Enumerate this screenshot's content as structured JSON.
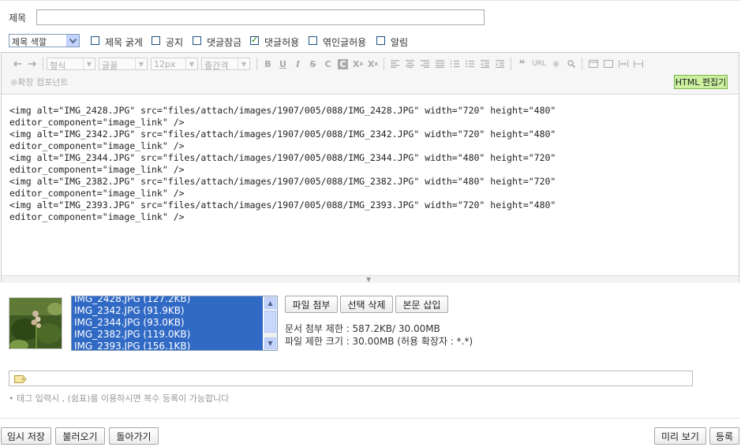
{
  "form": {
    "title_label": "제목",
    "title_value": "",
    "color_select": "제목 색깔",
    "checkboxes": [
      {
        "label": "제목 굵게",
        "checked": false
      },
      {
        "label": "공지",
        "checked": false
      },
      {
        "label": "댓글잠금",
        "checked": false
      },
      {
        "label": "댓글허용",
        "checked": true
      },
      {
        "label": "엮인글허용",
        "checked": false
      },
      {
        "label": "알림",
        "checked": false
      }
    ]
  },
  "toolbar": {
    "format_select": "형식",
    "font_select": "글꼴",
    "size_select": "12px",
    "spacing_select": "줄간격",
    "url_label": "URL",
    "extension_label": "확장 컴포넌트",
    "html_edit_label": "HTML 편집기"
  },
  "editor": {
    "lines": [
      "<img alt=\"IMG_2428.JPG\" src=\"files/attach/images/1907/005/088/IMG_2428.JPG\" width=\"720\" height=\"480\"",
      "editor_component=\"image_link\" />",
      "<img alt=\"IMG_2342.JPG\" src=\"files/attach/images/1907/005/088/IMG_2342.JPG\" width=\"720\" height=\"480\"",
      "editor_component=\"image_link\" />",
      "<img alt=\"IMG_2344.JPG\" src=\"files/attach/images/1907/005/088/IMG_2344.JPG\" width=\"480\" height=\"720\"",
      "editor_component=\"image_link\" />",
      "<img alt=\"IMG_2382.JPG\" src=\"files/attach/images/1907/005/088/IMG_2382.JPG\" width=\"480\" height=\"720\"",
      "editor_component=\"image_link\" />",
      "<img alt=\"IMG_2393.JPG\" src=\"files/attach/images/1907/005/088/IMG_2393.JPG\" width=\"720\" height=\"480\"",
      "editor_component=\"image_link\" />"
    ]
  },
  "attachments": {
    "files": [
      "IMG_2428.JPG (127.2KB)",
      "IMG_2342.JPG (91.9KB)",
      "IMG_2344.JPG (93.0KB)",
      "IMG_2382.JPG (119.0KB)",
      "IMG_2393.JPG (156.1KB)"
    ],
    "attach_button": "파일 첨부",
    "delete_button": "선택 삭제",
    "insert_button": "본문 삽입",
    "doc_limit": "문서 첨부 제한 : 587.2KB/ 30.00MB",
    "file_limit": "파일 제한 크기 : 30.00MB (허용 확장자 : *.*)"
  },
  "tags": {
    "value": "",
    "hint": "• 태그 입력시 , (쉼표)를 이용하시면 복수 등록이 가능합니다"
  },
  "actions": {
    "temp_save": "임시 저장",
    "load": "불러오기",
    "back": "돌아가기",
    "preview": "미리 보기",
    "submit": "등록"
  }
}
